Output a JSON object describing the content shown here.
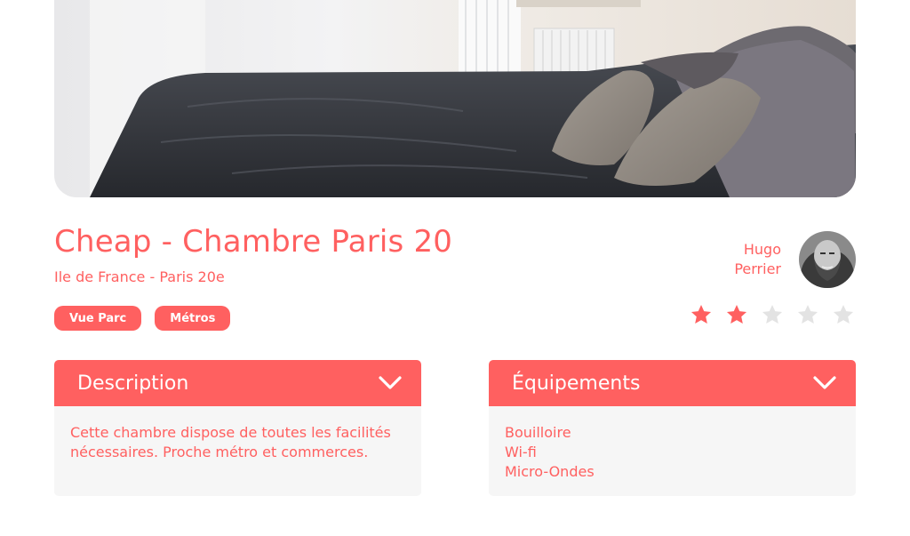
{
  "listing": {
    "title": "Cheap - Chambre Paris 20",
    "location": "Ile de France - Paris 20e",
    "tags": [
      "Vue Parc",
      "Métros"
    ],
    "photo_alt": "bed-photo"
  },
  "host": {
    "first_name": "Hugo",
    "last_name": "Perrier"
  },
  "rating": {
    "value": 2,
    "max": 5
  },
  "colors": {
    "accent": "#FF6060",
    "panel_bg": "#F6F6F6",
    "star_empty": "#E3E3E3"
  },
  "description": {
    "title": "Description",
    "text": "Cette chambre dispose de toutes les facilités nécessaires. Proche métro et commerces."
  },
  "equipments": {
    "title": "Équipements",
    "items": [
      "Bouilloire",
      "Wi-fi",
      "Micro-Ondes"
    ]
  }
}
